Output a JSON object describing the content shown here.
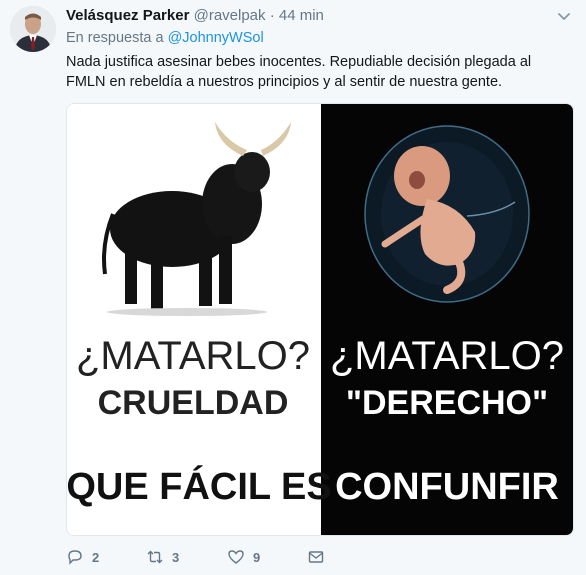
{
  "tweet": {
    "author_name": "Velásquez Parker",
    "author_handle": "@ravelpak",
    "separator": "·",
    "time": "44 min",
    "reply_prefix": "En respuesta a",
    "reply_to": "@JohnnyWSol",
    "body": "Nada justifica asesinar bebes inocentes. Repudiable decisión plegada al FMLN en rebeldía a nuestros principios y al sentir de nuestra gente.",
    "reply_count": "2",
    "retweet_count": "3",
    "like_count": "9"
  },
  "meme": {
    "left_question": "¿MATARLO?",
    "left_word": "CRUELDAD",
    "right_question": "¿MATARLO?",
    "right_word": "\"DERECHO\"",
    "bottom_left": "QUE FÁCIL ES",
    "bottom_right": "CONFUNFIR"
  },
  "colors": {
    "link": "#1b95e0",
    "muted": "#657786",
    "text": "#14171a",
    "background": "#f5f8fa"
  },
  "icons": [
    "chevron-down-icon",
    "reply-icon",
    "retweet-icon",
    "like-icon",
    "direct-message-icon"
  ]
}
